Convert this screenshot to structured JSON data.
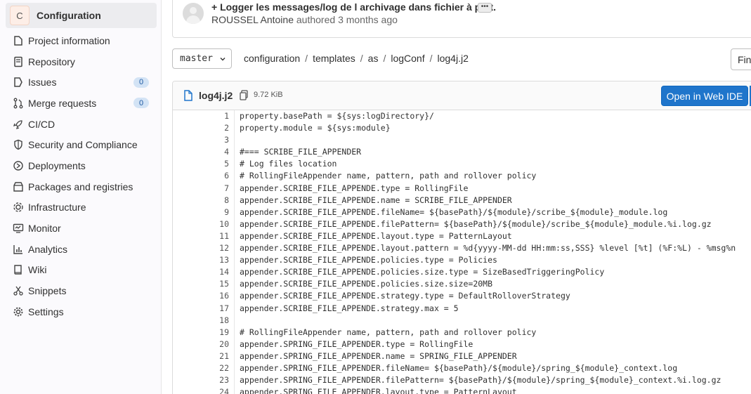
{
  "project": {
    "avatar_letter": "C",
    "name": "Configuration"
  },
  "sidebar": {
    "items": [
      {
        "icon": "project-icon",
        "label": "Project information"
      },
      {
        "icon": "repository-icon",
        "label": "Repository"
      },
      {
        "icon": "issues-icon",
        "label": "Issues",
        "badge": "0"
      },
      {
        "icon": "merge-request-icon",
        "label": "Merge requests",
        "badge": "0"
      },
      {
        "icon": "rocket-icon",
        "label": "CI/CD"
      },
      {
        "icon": "shield-icon",
        "label": "Security and Compliance"
      },
      {
        "icon": "deployments-icon",
        "label": "Deployments"
      },
      {
        "icon": "package-icon",
        "label": "Packages and registries"
      },
      {
        "icon": "infrastructure-icon",
        "label": "Infrastructure"
      },
      {
        "icon": "monitor-icon",
        "label": "Monitor"
      },
      {
        "icon": "analytics-icon",
        "label": "Analytics"
      },
      {
        "icon": "wiki-icon",
        "label": "Wiki"
      },
      {
        "icon": "snippet-icon",
        "label": "Snippets"
      },
      {
        "icon": "settings-icon",
        "label": "Settings"
      }
    ]
  },
  "commit": {
    "title": "+ Logger les messages/log de l archivage dans fichier à part.",
    "more": "•••",
    "author": "ROUSSEL Antoine",
    "authored": "authored",
    "time": "3 months ago"
  },
  "branch": {
    "name": "master"
  },
  "breadcrumb": [
    "configuration",
    "templates",
    "as",
    "logConf",
    "log4j.j2"
  ],
  "find_label": "Fin",
  "file": {
    "name": "log4j.j2",
    "size": "9.72 KiB",
    "open_web_ide": "Open in Web IDE",
    "lines": [
      {
        "n": "1",
        "t": "property.basePath = ${sys:logDirectory}/"
      },
      {
        "n": "2",
        "t": "property.module = ${sys:module}"
      },
      {
        "n": "3",
        "t": ""
      },
      {
        "n": "4",
        "t": "#=== SCRIBE_FILE_APPENDER"
      },
      {
        "n": "5",
        "t": "# Log files location"
      },
      {
        "n": "6",
        "t": "# RollingFileAppender name, pattern, path and rollover policy"
      },
      {
        "n": "7",
        "t": "appender.SCRIBE_FILE_APPENDE.type = RollingFile"
      },
      {
        "n": "8",
        "t": "appender.SCRIBE_FILE_APPENDE.name = SCRIBE_FILE_APPENDER"
      },
      {
        "n": "9",
        "t": "appender.SCRIBE_FILE_APPENDE.fileName= ${basePath}/${module}/scribe_${module}_module.log"
      },
      {
        "n": "10",
        "t": "appender.SCRIBE_FILE_APPENDE.filePattern= ${basePath}/${module}/scribe_${module}_module.%i.log.gz"
      },
      {
        "n": "11",
        "t": "appender.SCRIBE_FILE_APPENDE.layout.type = PatternLayout"
      },
      {
        "n": "12",
        "t": "appender.SCRIBE_FILE_APPENDE.layout.pattern = %d{yyyy-MM-dd HH:mm:ss,SSS} %level [%t] (%F:%L) - %msg%n"
      },
      {
        "n": "13",
        "t": "appender.SCRIBE_FILE_APPENDE.policies.type = Policies"
      },
      {
        "n": "14",
        "t": "appender.SCRIBE_FILE_APPENDE.policies.size.type = SizeBasedTriggeringPolicy"
      },
      {
        "n": "15",
        "t": "appender.SCRIBE_FILE_APPENDE.policies.size.size=20MB"
      },
      {
        "n": "16",
        "t": "appender.SCRIBE_FILE_APPENDE.strategy.type = DefaultRolloverStrategy"
      },
      {
        "n": "17",
        "t": "appender.SCRIBE_FILE_APPENDE.strategy.max = 5"
      },
      {
        "n": "18",
        "t": ""
      },
      {
        "n": "19",
        "t": "# RollingFileAppender name, pattern, path and rollover policy"
      },
      {
        "n": "20",
        "t": "appender.SPRING_FILE_APPENDER.type = RollingFile"
      },
      {
        "n": "21",
        "t": "appender.SPRING_FILE_APPENDER.name = SPRING_FILE_APPENDER"
      },
      {
        "n": "22",
        "t": "appender.SPRING_FILE_APPENDER.fileName= ${basePath}/${module}/spring_${module}_context.log"
      },
      {
        "n": "23",
        "t": "appender.SPRING_FILE_APPENDER.filePattern= ${basePath}/${module}/spring_${module}_context.%i.log.gz"
      },
      {
        "n": "24",
        "t": "appender.SPRING_FILE_APPENDER.layout.type = PatternLayout"
      }
    ]
  }
}
